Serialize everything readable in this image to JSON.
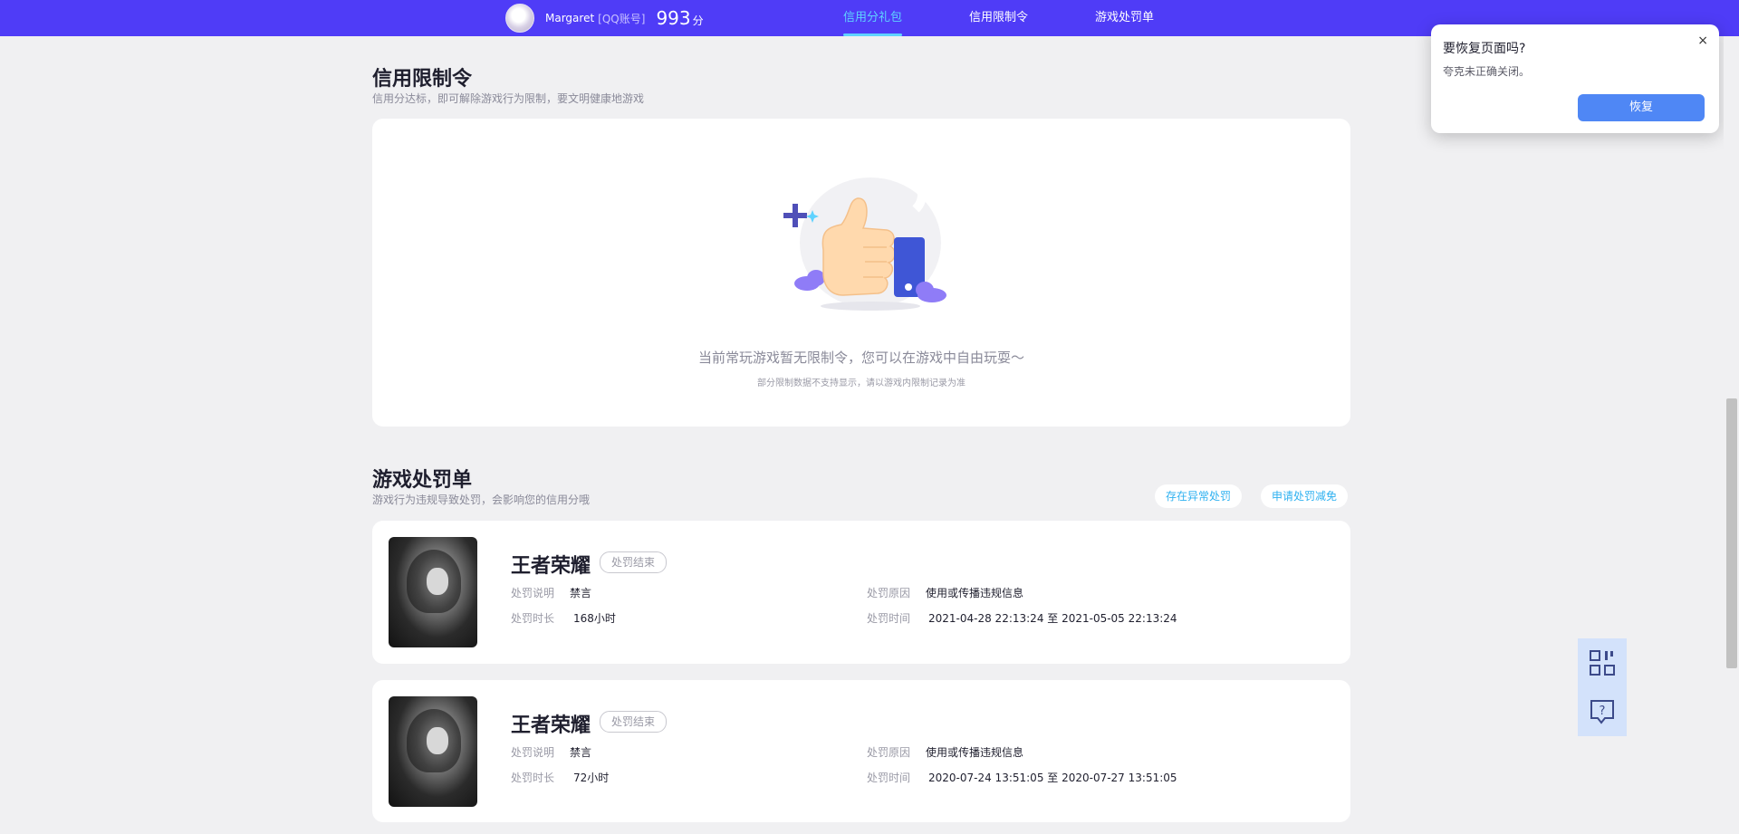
{
  "header": {
    "username": "Margaret",
    "account_type": "[QQ账号]",
    "score": "993",
    "score_unit": "分",
    "tabs": [
      {
        "label": "信用分礼包"
      },
      {
        "label": "信用限制令"
      },
      {
        "label": "游戏处罚单"
      }
    ],
    "active_tab": 0
  },
  "restriction": {
    "title": "信用限制令",
    "subtitle": "信用分达标，即可解除游戏行为限制，要文明健康地游戏",
    "empty_message": "当前常玩游戏暂无限制令，您可以在游戏中自由玩耍～",
    "empty_note": "部分限制数据不支持显示，请以游戏内限制记录为准"
  },
  "penalty": {
    "title": "游戏处罚单",
    "subtitle": "游戏行为违规导致处罚，会影响您的信用分哦",
    "actions": [
      {
        "label": "存在异常处罚"
      },
      {
        "label": "申请处罚减免"
      }
    ],
    "field_labels": {
      "desc": "处罚说明",
      "duration": "处罚时长",
      "reason": "处罚原因",
      "time": "处罚时间"
    },
    "items": [
      {
        "game": "王者荣耀",
        "status": "处罚结束",
        "desc": "禁言",
        "duration": "168小时",
        "reason": "使用或传播违规信息",
        "time": "2021-04-28 22:13:24 至 2021-05-05 22:13:24"
      },
      {
        "game": "王者荣耀",
        "status": "处罚结束",
        "desc": "禁言",
        "duration": "72小时",
        "reason": "使用或传播违规信息",
        "time": "2020-07-24 13:51:05 至 2020-07-27 13:51:05"
      }
    ]
  },
  "dialog": {
    "title": "要恢复页面吗?",
    "body": "夸克未正确关闭。",
    "button": "恢复",
    "close_icon": "×"
  },
  "floating": {
    "icons": [
      "qr-code-icon",
      "feedback-icon"
    ],
    "feedback_glyph": "?"
  },
  "colors": {
    "nav_bg": "#4f3cf7",
    "accent": "#5fd3ff",
    "link": "#2fb1f0",
    "primary_button": "#4f87f5"
  }
}
